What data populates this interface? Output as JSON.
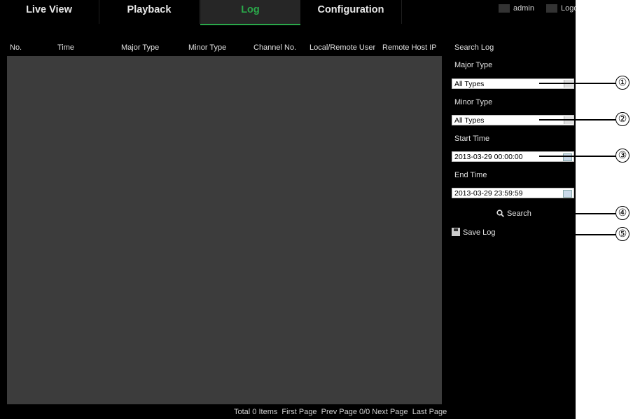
{
  "nav": {
    "tabs": [
      {
        "label": "Live View"
      },
      {
        "label": "Playback"
      },
      {
        "label": "Log"
      },
      {
        "label": "Configuration"
      }
    ],
    "active_tab": "Log",
    "user": "admin",
    "logout": "Logout"
  },
  "table": {
    "columns": [
      "No.",
      "Time",
      "Major Type",
      "Minor Type",
      "Channel No.",
      "Local/Remote User",
      "Remote Host IP"
    ]
  },
  "pager": {
    "total": "Total 0 Items",
    "first": "First Page",
    "prev": "Prev Page",
    "page": "0/0",
    "next": "Next Page",
    "last": "Last Page"
  },
  "search_panel": {
    "title": "Search Log",
    "major_type_label": "Major Type",
    "major_type_value": "All Types",
    "minor_type_label": "Minor Type",
    "minor_type_value": "All Types",
    "start_time_label": "Start Time",
    "start_time_value": "2013-03-29 00:00:00",
    "end_time_label": "End Time",
    "end_time_value": "2013-03-29 23:59:59",
    "search_label": "Search",
    "save_log_label": "Save Log"
  },
  "callouts": [
    "①",
    "②",
    "③",
    "④",
    "⑤"
  ]
}
